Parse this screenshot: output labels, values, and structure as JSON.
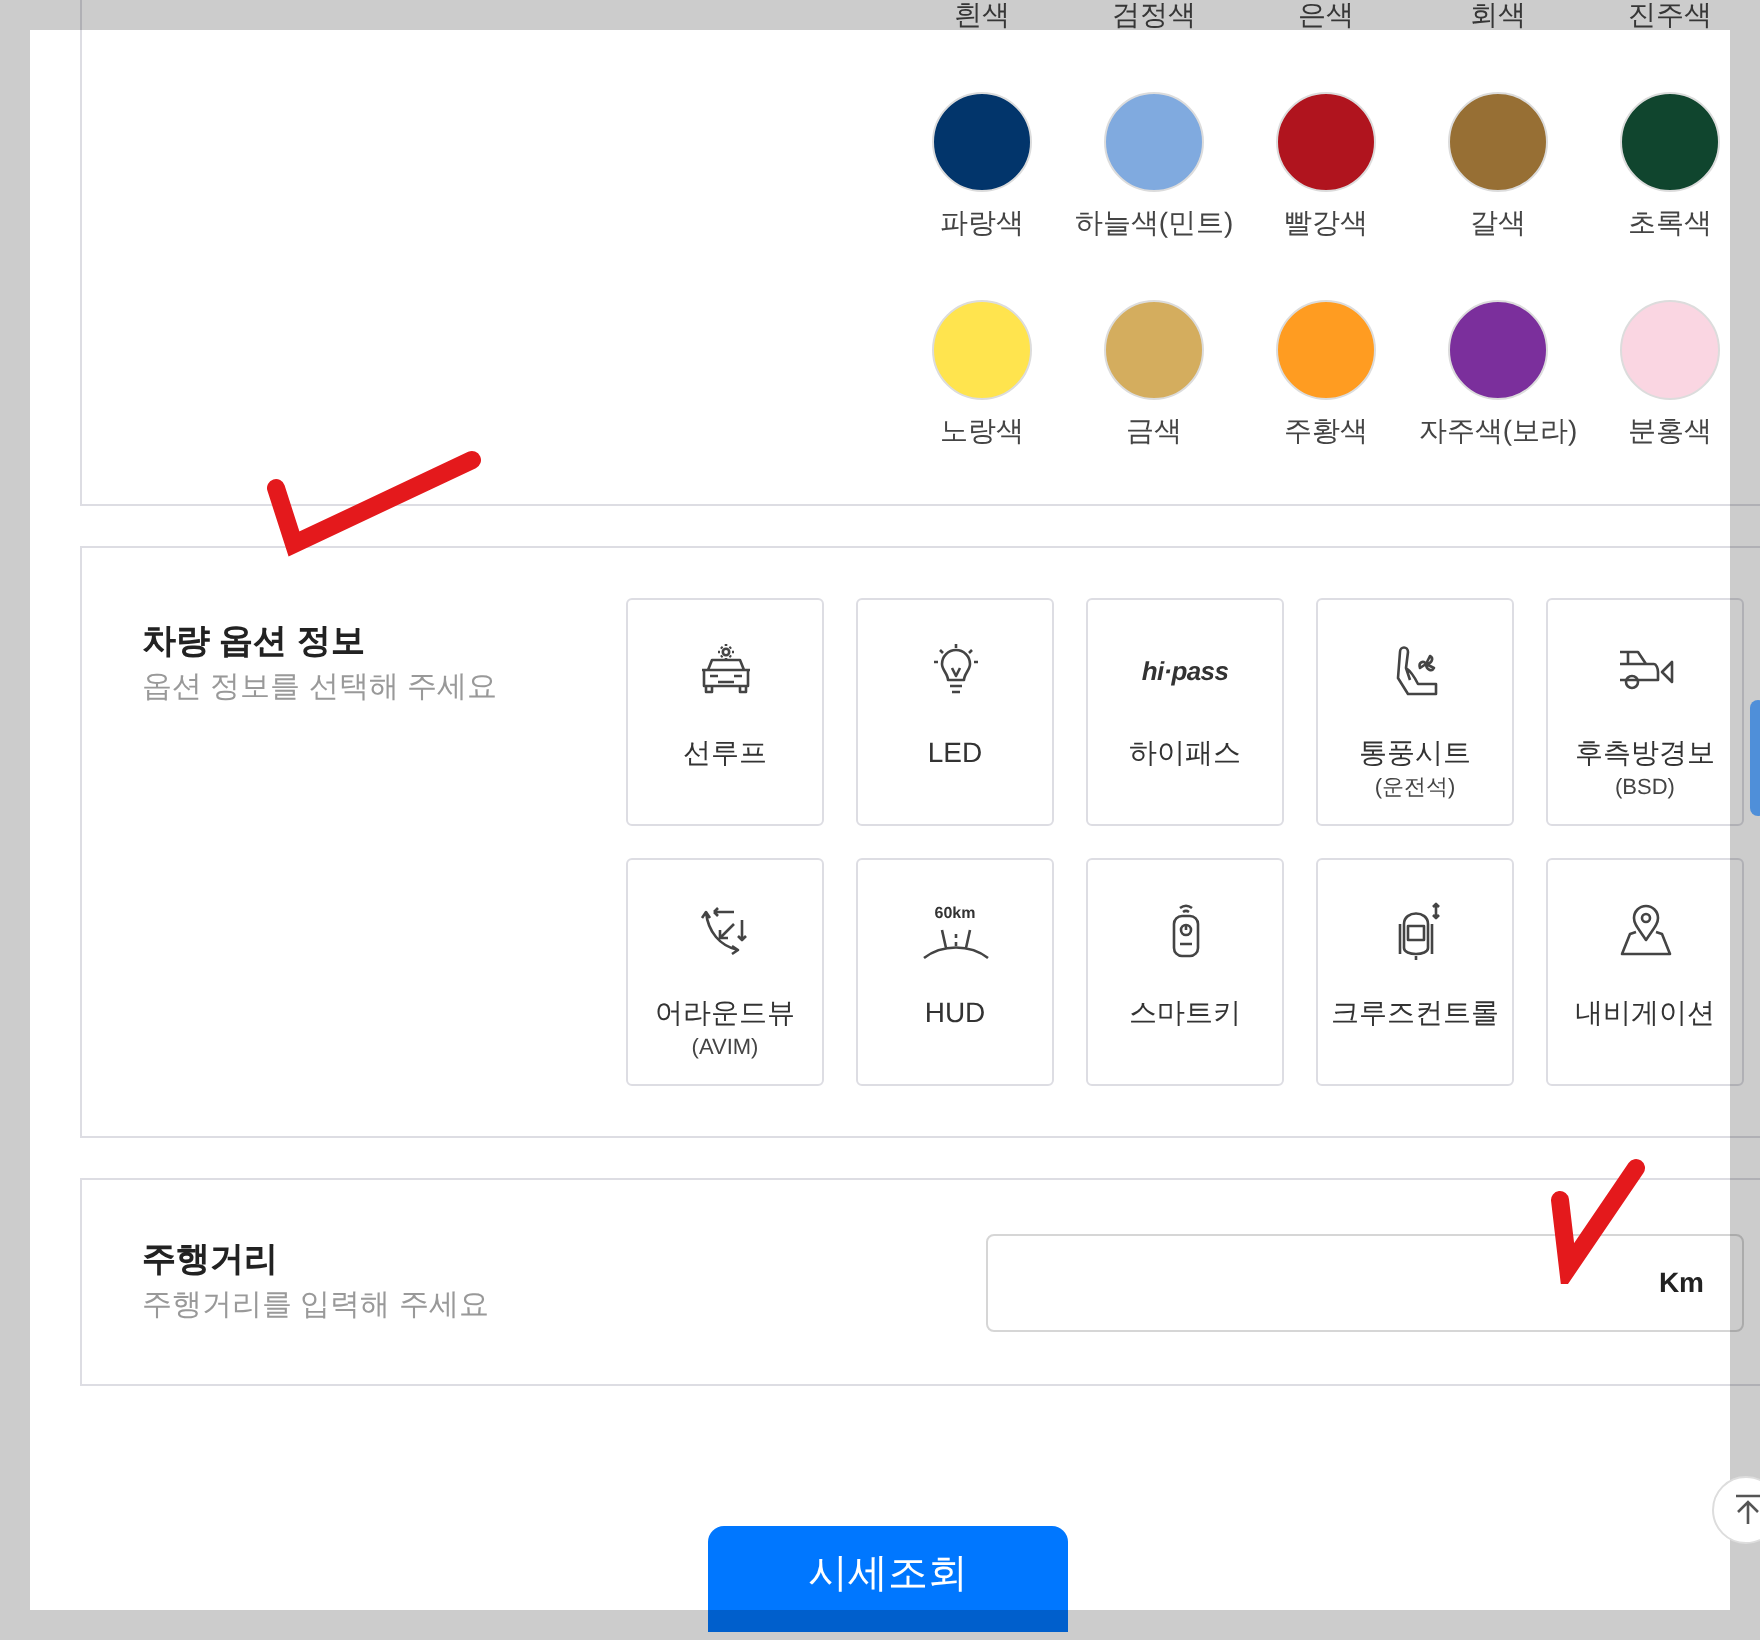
{
  "colors": [
    {
      "name": "흰색"
    },
    {
      "name": "검정색"
    },
    {
      "name": "은색"
    },
    {
      "name": "회색"
    },
    {
      "name": "진주색"
    },
    {
      "name": "파랑색",
      "color": "#02356b"
    },
    {
      "name": "하늘색(민트)",
      "color": "#80aadf"
    },
    {
      "name": "빨강색",
      "color": "#b0141e"
    },
    {
      "name": "갈색",
      "color": "#976f34"
    },
    {
      "name": "초록색",
      "color": "#10452e"
    },
    {
      "name": "노랑색",
      "color": "#ffe44e"
    },
    {
      "name": "금색",
      "color": "#d4ad5e"
    },
    {
      "name": "주황색",
      "color": "#ff9c21"
    },
    {
      "name": "자주색(보라)",
      "color": "#7b2f9c"
    },
    {
      "name": "분홍색",
      "color": "#fad6e2"
    }
  ],
  "options_section": {
    "title": "차량 옵션 정보",
    "subtitle": "옵션 정보를 선택해 주세요",
    "options": [
      {
        "kind": "sunroof",
        "label": "선루프"
      },
      {
        "kind": "led",
        "label": "LED"
      },
      {
        "kind": "hipass",
        "label": "하이패스",
        "logo": "hi·pass"
      },
      {
        "kind": "seat",
        "label": "통풍시트",
        "sublabel": "(운전석)"
      },
      {
        "kind": "bsd",
        "label": "후측방경보",
        "sublabel": "(BSD)"
      },
      {
        "kind": "aroundview",
        "label": "어라운드뷰",
        "sublabel": "(AVIM)"
      },
      {
        "kind": "hud",
        "label": "HUD",
        "icon_text": "60km"
      },
      {
        "kind": "smartkey",
        "label": "스마트키"
      },
      {
        "kind": "cruise",
        "label": "크루즈컨트롤"
      },
      {
        "kind": "navigation",
        "label": "내비게이션"
      }
    ]
  },
  "mileage_section": {
    "title": "주행거리",
    "subtitle": "주행거리를 입력해 주세요",
    "unit": "Km"
  },
  "submit_button": "시세조회"
}
